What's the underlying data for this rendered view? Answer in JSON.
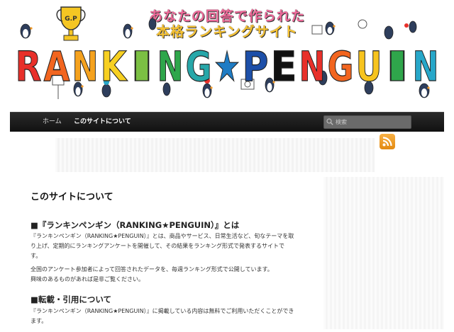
{
  "banner": {
    "tagline_line1": "あなたの回答で作られた",
    "tagline_line2": "本格ランキングサイト",
    "logo_text": "RANKING★PENGUIN",
    "logo_colors": [
      "#e8302a",
      "#f2651f",
      "#f5a21e",
      "#f7d021",
      "#7bc043",
      "#2fa64b",
      "#27a7a9",
      "#1f7cc4",
      "#1d4fa8",
      "#111111",
      "#e8302a",
      "#f2651f",
      "#f7c41e",
      "#2fa64b",
      "#27a7c9",
      "#3b4fb8"
    ],
    "trophy_text": "G.P"
  },
  "nav": {
    "home_label": "ホーム",
    "about_label": "このサイトについて",
    "search_placeholder": "検索"
  },
  "main": {
    "page_title": "このサイトについて",
    "section1_heading": "■『ランキンペンギン（RANKING★PENGUIN）』とは",
    "section1_paragraph1_line1": "『ランキンペンギン（RANKING★PENGUIN）』とは、商品やサービス、日常生活など、旬なテーマを取",
    "section1_paragraph1_line2": "り上げ、定期的にランキングアンケートを開催して、その結果をランキング形式で発表するサイトで",
    "section1_paragraph1_line3": "す。",
    "section1_paragraph2_line1": "全国のアンケート参加者によって回答されたデータを、毎週ランキング形式で公開しています。",
    "section1_paragraph2_line2": "興味のあるものがあれば是非ご覧ください。",
    "section2_heading": "■転載・引用について",
    "section2_paragraph_line1": "『ランキンペンギン（RANKING★PENGUIN）』に掲載している内容は無料でご利用いただくことができ",
    "section2_paragraph_line2": "ます。"
  },
  "colors": {
    "nav_bg": "#1a1a1a",
    "rss_orange": "#f0a030",
    "text_dark": "#222222"
  },
  "icons": [
    "trophy-icon",
    "penguin-illustration",
    "search-icon",
    "rss-icon"
  ]
}
